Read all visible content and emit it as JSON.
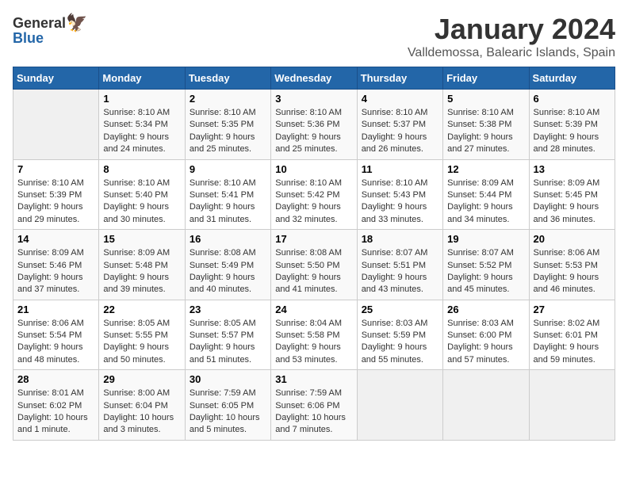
{
  "header": {
    "logo_general": "General",
    "logo_blue": "Blue",
    "title": "January 2024",
    "subtitle": "Valldemossa, Balearic Islands, Spain"
  },
  "weekdays": [
    "Sunday",
    "Monday",
    "Tuesday",
    "Wednesday",
    "Thursday",
    "Friday",
    "Saturday"
  ],
  "weeks": [
    [
      {
        "day": "",
        "sunrise": "",
        "sunset": "",
        "daylight": ""
      },
      {
        "day": "1",
        "sunrise": "Sunrise: 8:10 AM",
        "sunset": "Sunset: 5:34 PM",
        "daylight": "Daylight: 9 hours and 24 minutes."
      },
      {
        "day": "2",
        "sunrise": "Sunrise: 8:10 AM",
        "sunset": "Sunset: 5:35 PM",
        "daylight": "Daylight: 9 hours and 25 minutes."
      },
      {
        "day": "3",
        "sunrise": "Sunrise: 8:10 AM",
        "sunset": "Sunset: 5:36 PM",
        "daylight": "Daylight: 9 hours and 25 minutes."
      },
      {
        "day": "4",
        "sunrise": "Sunrise: 8:10 AM",
        "sunset": "Sunset: 5:37 PM",
        "daylight": "Daylight: 9 hours and 26 minutes."
      },
      {
        "day": "5",
        "sunrise": "Sunrise: 8:10 AM",
        "sunset": "Sunset: 5:38 PM",
        "daylight": "Daylight: 9 hours and 27 minutes."
      },
      {
        "day": "6",
        "sunrise": "Sunrise: 8:10 AM",
        "sunset": "Sunset: 5:39 PM",
        "daylight": "Daylight: 9 hours and 28 minutes."
      }
    ],
    [
      {
        "day": "7",
        "sunrise": "Sunrise: 8:10 AM",
        "sunset": "Sunset: 5:39 PM",
        "daylight": "Daylight: 9 hours and 29 minutes."
      },
      {
        "day": "8",
        "sunrise": "Sunrise: 8:10 AM",
        "sunset": "Sunset: 5:40 PM",
        "daylight": "Daylight: 9 hours and 30 minutes."
      },
      {
        "day": "9",
        "sunrise": "Sunrise: 8:10 AM",
        "sunset": "Sunset: 5:41 PM",
        "daylight": "Daylight: 9 hours and 31 minutes."
      },
      {
        "day": "10",
        "sunrise": "Sunrise: 8:10 AM",
        "sunset": "Sunset: 5:42 PM",
        "daylight": "Daylight: 9 hours and 32 minutes."
      },
      {
        "day": "11",
        "sunrise": "Sunrise: 8:10 AM",
        "sunset": "Sunset: 5:43 PM",
        "daylight": "Daylight: 9 hours and 33 minutes."
      },
      {
        "day": "12",
        "sunrise": "Sunrise: 8:09 AM",
        "sunset": "Sunset: 5:44 PM",
        "daylight": "Daylight: 9 hours and 34 minutes."
      },
      {
        "day": "13",
        "sunrise": "Sunrise: 8:09 AM",
        "sunset": "Sunset: 5:45 PM",
        "daylight": "Daylight: 9 hours and 36 minutes."
      }
    ],
    [
      {
        "day": "14",
        "sunrise": "Sunrise: 8:09 AM",
        "sunset": "Sunset: 5:46 PM",
        "daylight": "Daylight: 9 hours and 37 minutes."
      },
      {
        "day": "15",
        "sunrise": "Sunrise: 8:09 AM",
        "sunset": "Sunset: 5:48 PM",
        "daylight": "Daylight: 9 hours and 39 minutes."
      },
      {
        "day": "16",
        "sunrise": "Sunrise: 8:08 AM",
        "sunset": "Sunset: 5:49 PM",
        "daylight": "Daylight: 9 hours and 40 minutes."
      },
      {
        "day": "17",
        "sunrise": "Sunrise: 8:08 AM",
        "sunset": "Sunset: 5:50 PM",
        "daylight": "Daylight: 9 hours and 41 minutes."
      },
      {
        "day": "18",
        "sunrise": "Sunrise: 8:07 AM",
        "sunset": "Sunset: 5:51 PM",
        "daylight": "Daylight: 9 hours and 43 minutes."
      },
      {
        "day": "19",
        "sunrise": "Sunrise: 8:07 AM",
        "sunset": "Sunset: 5:52 PM",
        "daylight": "Daylight: 9 hours and 45 minutes."
      },
      {
        "day": "20",
        "sunrise": "Sunrise: 8:06 AM",
        "sunset": "Sunset: 5:53 PM",
        "daylight": "Daylight: 9 hours and 46 minutes."
      }
    ],
    [
      {
        "day": "21",
        "sunrise": "Sunrise: 8:06 AM",
        "sunset": "Sunset: 5:54 PM",
        "daylight": "Daylight: 9 hours and 48 minutes."
      },
      {
        "day": "22",
        "sunrise": "Sunrise: 8:05 AM",
        "sunset": "Sunset: 5:55 PM",
        "daylight": "Daylight: 9 hours and 50 minutes."
      },
      {
        "day": "23",
        "sunrise": "Sunrise: 8:05 AM",
        "sunset": "Sunset: 5:57 PM",
        "daylight": "Daylight: 9 hours and 51 minutes."
      },
      {
        "day": "24",
        "sunrise": "Sunrise: 8:04 AM",
        "sunset": "Sunset: 5:58 PM",
        "daylight": "Daylight: 9 hours and 53 minutes."
      },
      {
        "day": "25",
        "sunrise": "Sunrise: 8:03 AM",
        "sunset": "Sunset: 5:59 PM",
        "daylight": "Daylight: 9 hours and 55 minutes."
      },
      {
        "day": "26",
        "sunrise": "Sunrise: 8:03 AM",
        "sunset": "Sunset: 6:00 PM",
        "daylight": "Daylight: 9 hours and 57 minutes."
      },
      {
        "day": "27",
        "sunrise": "Sunrise: 8:02 AM",
        "sunset": "Sunset: 6:01 PM",
        "daylight": "Daylight: 9 hours and 59 minutes."
      }
    ],
    [
      {
        "day": "28",
        "sunrise": "Sunrise: 8:01 AM",
        "sunset": "Sunset: 6:02 PM",
        "daylight": "Daylight: 10 hours and 1 minute."
      },
      {
        "day": "29",
        "sunrise": "Sunrise: 8:00 AM",
        "sunset": "Sunset: 6:04 PM",
        "daylight": "Daylight: 10 hours and 3 minutes."
      },
      {
        "day": "30",
        "sunrise": "Sunrise: 7:59 AM",
        "sunset": "Sunset: 6:05 PM",
        "daylight": "Daylight: 10 hours and 5 minutes."
      },
      {
        "day": "31",
        "sunrise": "Sunrise: 7:59 AM",
        "sunset": "Sunset: 6:06 PM",
        "daylight": "Daylight: 10 hours and 7 minutes."
      },
      {
        "day": "",
        "sunrise": "",
        "sunset": "",
        "daylight": ""
      },
      {
        "day": "",
        "sunrise": "",
        "sunset": "",
        "daylight": ""
      },
      {
        "day": "",
        "sunrise": "",
        "sunset": "",
        "daylight": ""
      }
    ]
  ]
}
